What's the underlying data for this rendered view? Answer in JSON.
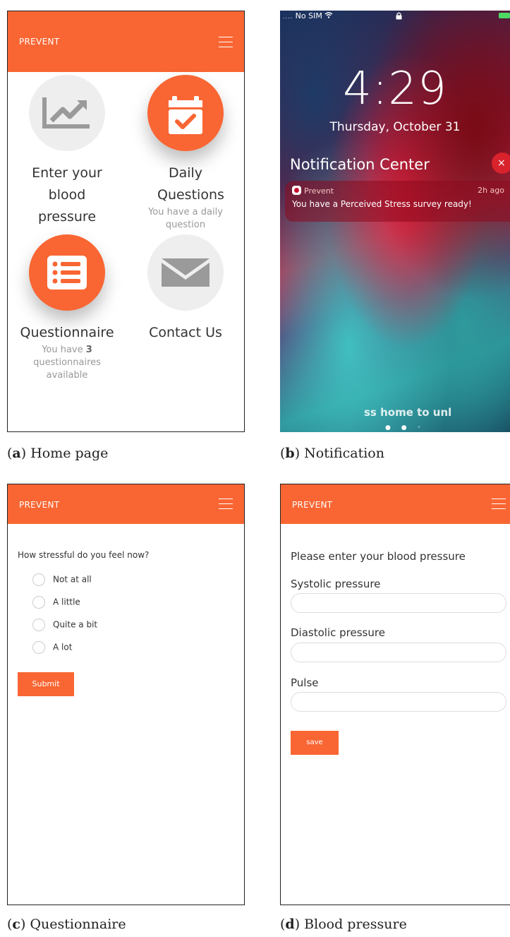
{
  "panel_a": {
    "app_title": "PREVENT",
    "tiles": [
      {
        "label": "Enter your blood pressure",
        "sub": "",
        "icon": "chart-icon"
      },
      {
        "label": "Daily Questions",
        "sub": "You have a daily question",
        "icon": "calendar-check-icon"
      },
      {
        "label": "Questionnaire",
        "sub_prefix": "You have",
        "sub_count": "3",
        "sub_suffix": "questionnaires available",
        "icon": "list-icon"
      },
      {
        "label": "Contact Us",
        "sub": "",
        "icon": "envelope-icon"
      }
    ],
    "caption_letter": "a",
    "caption_text": "Home page"
  },
  "panel_b": {
    "carrier": "No SIM",
    "time": "4:29",
    "date": "Thursday, October 31",
    "notification_center": "Notification Center",
    "close": "×",
    "notif_app": "Prevent",
    "notif_age": "2h ago",
    "notif_msg": "You have a Perceived Stress survey ready!",
    "unlock_hint": "ss home to unl",
    "caption_letter": "b",
    "caption_text": "Notification"
  },
  "panel_c": {
    "app_title": "PREVENT",
    "question": "How stressful do you feel now?",
    "options": [
      "Not at all",
      "A little",
      "Quite a bit",
      "A lot"
    ],
    "submit": "Submit",
    "caption_letter": "c",
    "caption_text": "Questionnaire"
  },
  "panel_d": {
    "app_title": "PREVENT",
    "heading": "Please enter your blood pressure",
    "fields": [
      "Systolic pressure",
      "Diastolic pressure",
      "Pulse"
    ],
    "save": "save",
    "caption_letter": "d",
    "caption_text": "Blood pressure"
  },
  "colors": {
    "accent": "#f96633",
    "grey_circle": "#eeeeee",
    "icon_grey": "#999999"
  }
}
